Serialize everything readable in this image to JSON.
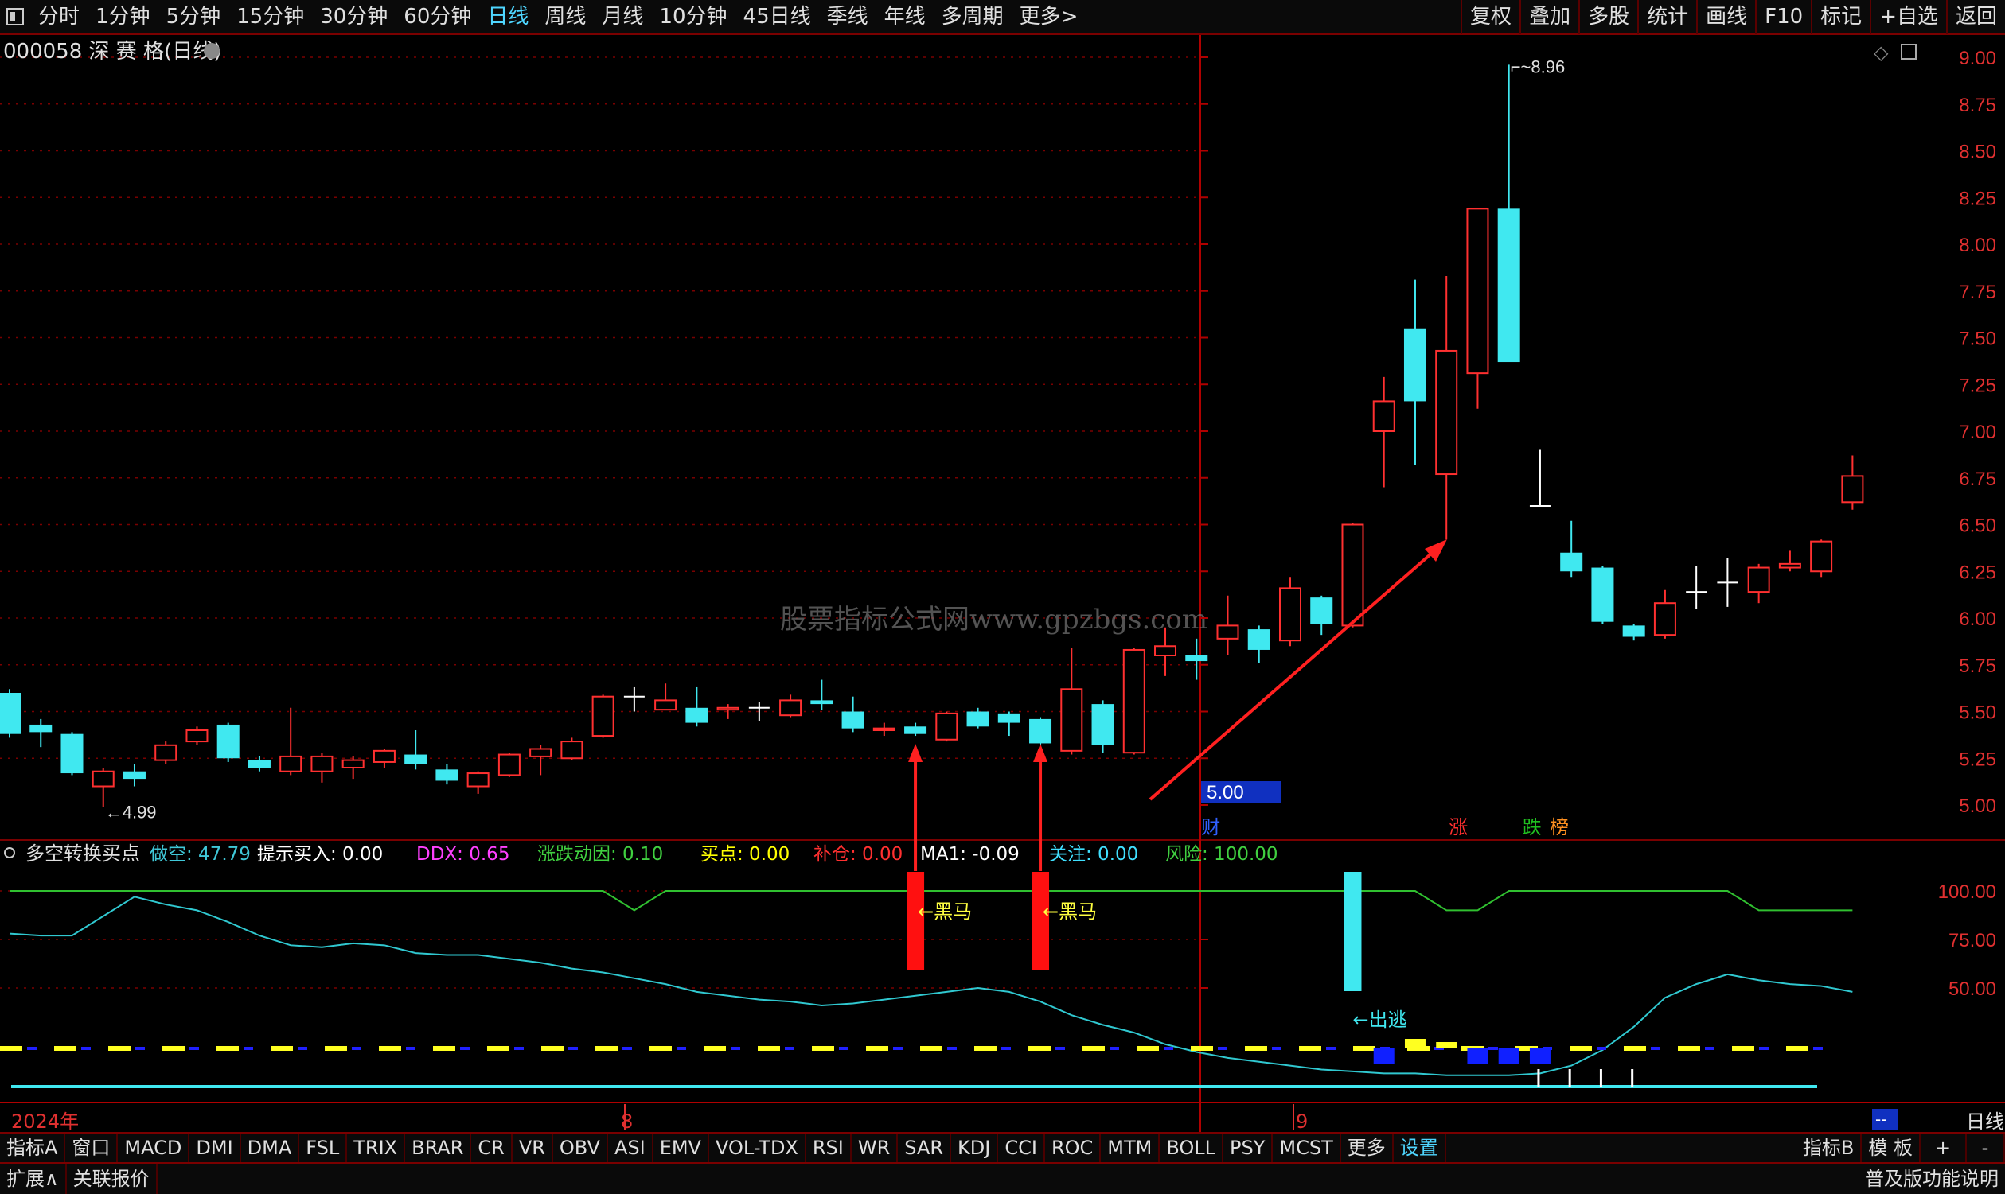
{
  "toolbar_left": [
    "分时",
    "1分钟",
    "5分钟",
    "15分钟",
    "30分钟",
    "60分钟",
    "日线",
    "周线",
    "月线",
    "10分钟",
    "45日线",
    "季线",
    "年线",
    "多周期",
    "更多>"
  ],
  "toolbar_active": "日线",
  "toolbar_right": [
    "复权",
    "叠加",
    "多股",
    "统计",
    "画线",
    "F10",
    "标记",
    "+自选",
    "返回"
  ],
  "stock_title": "000058 深 赛 格(日线)",
  "watermark": "股票指标公式网www.gpzbgs.com",
  "price_axis": [
    "9.00",
    "8.75",
    "8.50",
    "8.25",
    "8.00",
    "7.75",
    "7.50",
    "7.25",
    "7.00",
    "6.75",
    "6.50",
    "6.25",
    "6.00",
    "5.75",
    "5.50",
    "5.25",
    "5.00"
  ],
  "current_price_tag": "5.00",
  "high_label": "8.96",
  "low_label": "4.99",
  "event_tags": [
    "财",
    "涨",
    "跌",
    "榜"
  ],
  "indicator": {
    "name": "多空转换买点",
    "fields": [
      {
        "label": "做空:",
        "value": "47.79",
        "color": "#40c8d8"
      },
      {
        "label": "提示买入:",
        "value": "0.00",
        "color": "#ffffff"
      },
      {
        "label": "DDX:",
        "value": "0.65",
        "color": "#ff40ff"
      },
      {
        "label": "涨跌动因:",
        "value": "0.10",
        "color": "#40d040"
      },
      {
        "label": "买点:",
        "value": "0.00",
        "color": "#ffff00"
      },
      {
        "label": "补仓:",
        "value": "0.00",
        "color": "#ff3030"
      },
      {
        "label": "MA1:",
        "value": "-0.09",
        "color": "#ffffff"
      },
      {
        "label": "关注:",
        "value": "0.00",
        "color": "#40e0ff"
      },
      {
        "label": "风险:",
        "value": "100.00",
        "color": "#40d040"
      }
    ],
    "axis": [
      "100.00",
      "75.00",
      "50.00"
    ],
    "annotations": [
      "←黑马",
      "←黑马",
      "←出逃"
    ]
  },
  "date_axis": {
    "year": "2024年",
    "marks": [
      "8",
      "9"
    ],
    "right_label": "日线",
    "right_box": "--"
  },
  "chart_data": {
    "type": "candlestick",
    "ylim": [
      4.9,
      9.05
    ],
    "candles": [
      [
        5.6,
        5.38,
        5.62,
        5.36
      ],
      [
        5.43,
        5.39,
        5.46,
        5.31
      ],
      [
        5.38,
        5.17,
        5.39,
        5.16
      ],
      [
        5.1,
        5.18,
        5.2,
        4.99
      ],
      [
        5.18,
        5.14,
        5.22,
        5.1
      ],
      [
        5.24,
        5.32,
        5.34,
        5.22
      ],
      [
        5.34,
        5.4,
        5.42,
        5.32
      ],
      [
        5.43,
        5.25,
        5.44,
        5.23
      ],
      [
        5.24,
        5.2,
        5.26,
        5.18
      ],
      [
        5.18,
        5.26,
        5.52,
        5.16
      ],
      [
        5.18,
        5.26,
        5.28,
        5.12
      ],
      [
        5.2,
        5.24,
        5.26,
        5.14
      ],
      [
        5.23,
        5.29,
        5.3,
        5.2
      ],
      [
        5.27,
        5.22,
        5.4,
        5.19
      ],
      [
        5.19,
        5.13,
        5.22,
        5.11
      ],
      [
        5.1,
        5.17,
        5.18,
        5.06
      ],
      [
        5.16,
        5.27,
        5.28,
        5.15
      ],
      [
        5.26,
        5.3,
        5.32,
        5.16
      ],
      [
        5.25,
        5.34,
        5.36,
        5.24
      ],
      [
        5.37,
        5.58,
        5.59,
        5.36
      ],
      [
        5.58,
        5.58,
        5.63,
        5.5
      ],
      [
        5.51,
        5.56,
        5.65,
        5.52
      ],
      [
        5.52,
        5.44,
        5.63,
        5.42
      ],
      [
        5.51,
        5.52,
        5.54,
        5.46
      ],
      [
        5.52,
        5.52,
        5.55,
        5.45
      ],
      [
        5.48,
        5.56,
        5.59,
        5.47
      ],
      [
        5.56,
        5.54,
        5.67,
        5.51
      ],
      [
        5.5,
        5.41,
        5.58,
        5.39
      ],
      [
        5.4,
        5.41,
        5.44,
        5.37
      ],
      [
        5.42,
        5.38,
        5.44,
        5.37
      ],
      [
        5.35,
        5.49,
        5.5,
        5.34
      ],
      [
        5.5,
        5.42,
        5.52,
        5.41
      ],
      [
        5.49,
        5.44,
        5.5,
        5.37
      ],
      [
        5.46,
        5.33,
        5.47,
        5.3
      ],
      [
        5.29,
        5.62,
        5.84,
        5.27
      ],
      [
        5.54,
        5.32,
        5.56,
        5.28
      ],
      [
        5.28,
        5.83,
        5.84,
        5.27
      ],
      [
        5.8,
        5.85,
        5.95,
        5.69
      ],
      [
        5.8,
        5.77,
        5.89,
        5.67
      ],
      [
        5.89,
        5.96,
        6.12,
        5.8
      ],
      [
        5.94,
        5.83,
        5.96,
        5.76
      ],
      [
        5.88,
        6.16,
        6.22,
        5.85
      ],
      [
        6.11,
        5.97,
        6.12,
        5.91
      ],
      [
        5.96,
        6.5,
        6.51,
        5.95
      ],
      [
        7.0,
        7.16,
        7.29,
        6.7
      ],
      [
        7.55,
        7.16,
        7.81,
        6.82
      ],
      [
        6.77,
        7.43,
        7.83,
        6.42
      ],
      [
        7.31,
        8.19,
        8.19,
        7.12
      ],
      [
        8.19,
        7.37,
        8.96,
        7.37
      ],
      [
        6.6,
        6.6,
        6.9,
        6.6
      ],
      [
        6.35,
        6.25,
        6.52,
        6.22
      ],
      [
        6.27,
        5.98,
        6.28,
        5.97
      ],
      [
        5.96,
        5.9,
        5.97,
        5.88
      ],
      [
        5.91,
        6.08,
        6.15,
        5.89
      ],
      [
        6.14,
        6.14,
        6.28,
        6.05
      ],
      [
        6.19,
        6.19,
        6.32,
        6.06
      ],
      [
        6.14,
        6.27,
        6.29,
        6.08
      ],
      [
        6.27,
        6.29,
        6.36,
        6.25
      ],
      [
        6.25,
        6.41,
        6.42,
        6.22
      ],
      [
        6.62,
        6.76,
        6.87,
        6.58
      ]
    ],
    "indicator_series": {
      "ylim": [
        0,
        125
      ],
      "green_line": [
        100,
        100,
        100,
        100,
        100,
        100,
        100,
        100,
        100,
        100,
        100,
        100,
        100,
        100,
        100,
        100,
        100,
        100,
        100,
        100,
        90,
        100,
        100,
        100,
        100,
        100,
        100,
        100,
        100,
        100,
        100,
        100,
        100,
        100,
        100,
        100,
        100,
        100,
        100,
        100,
        100,
        100,
        100,
        100,
        100,
        100,
        90,
        90,
        100,
        100,
        100,
        100,
        100,
        100,
        100,
        100,
        90,
        90,
        90,
        90
      ],
      "cyan_line": [
        78,
        77,
        77,
        87,
        97,
        93,
        90,
        84,
        77,
        72,
        71,
        73,
        72,
        68,
        67,
        67,
        65,
        63,
        60,
        58,
        55,
        52,
        48,
        46,
        44,
        43,
        41,
        42,
        44,
        46,
        48,
        50,
        48,
        43,
        36,
        31,
        27,
        21,
        17,
        14,
        12,
        10,
        8,
        7,
        6,
        6,
        5,
        5,
        5,
        6,
        10,
        18,
        30,
        45,
        52,
        57,
        54,
        52,
        51,
        48
      ],
      "red_bars": [
        29,
        33
      ],
      "cyan_bar": 43,
      "blue_blocks": [
        44,
        47,
        48,
        49
      ],
      "white_ticks": [
        49,
        50,
        51,
        52
      ]
    }
  }
}
